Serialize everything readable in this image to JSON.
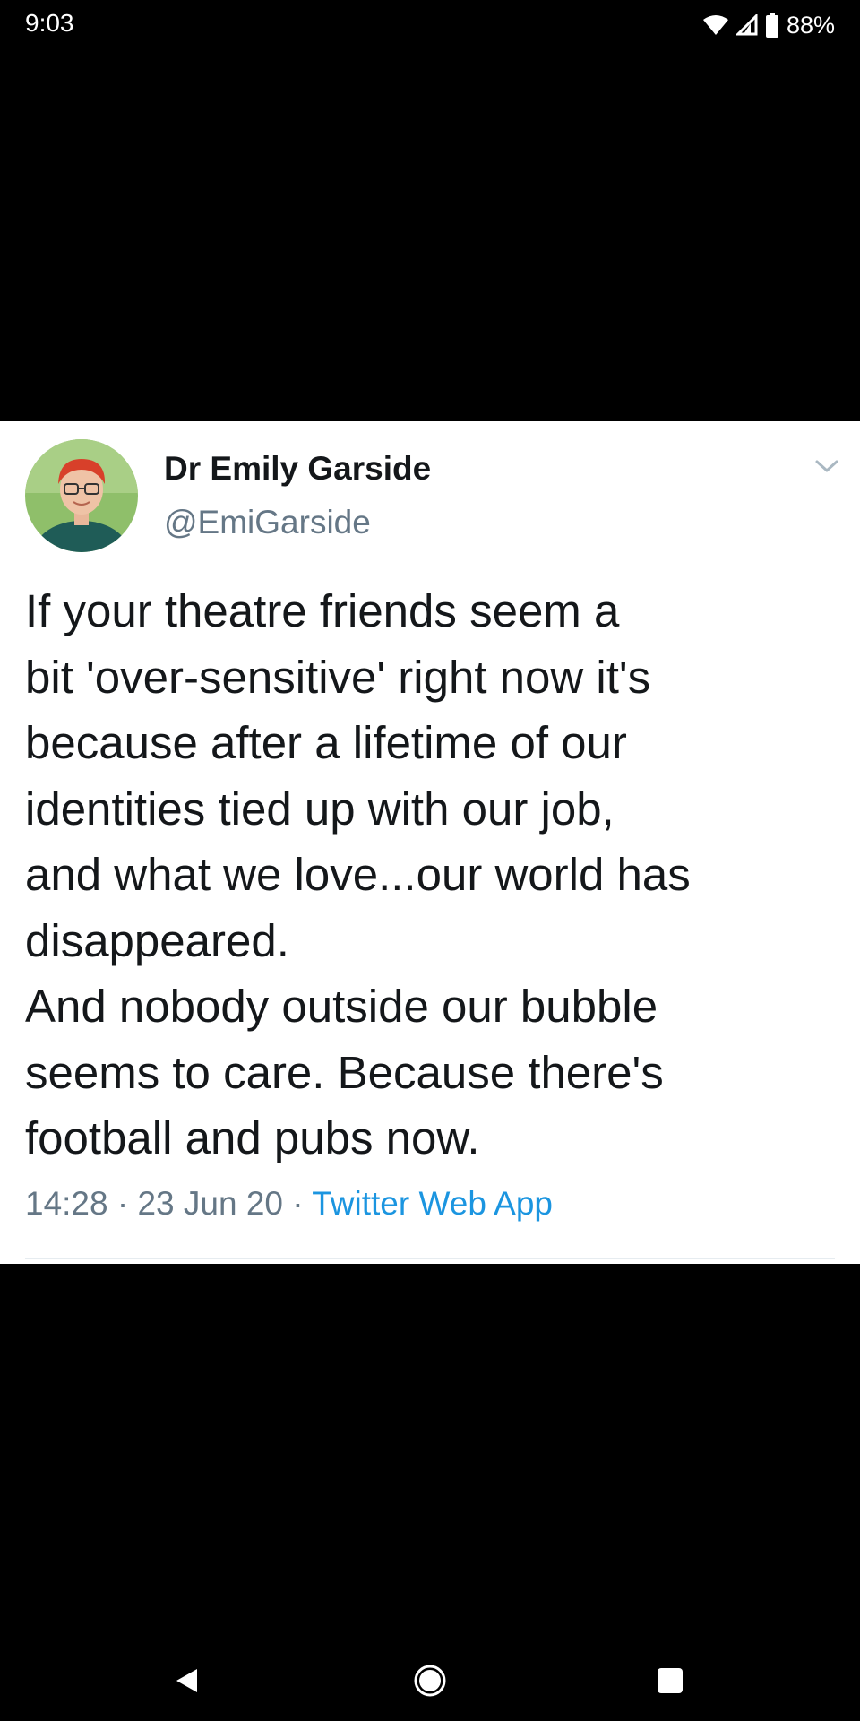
{
  "status_bar": {
    "time": "9:03",
    "battery": "88%",
    "icons": [
      "wifi-icon",
      "cellular-signal-icon",
      "battery-icon"
    ]
  },
  "tweet": {
    "display_name": "Dr Emily Garside",
    "handle": "@EmiGarside",
    "text_lines": [
      "If your theatre friends seem a",
      "bit 'over-sensitive' right now it's",
      "because after a lifetime of our",
      "identities tied up with our job,",
      "and what we love...our world has",
      "disappeared.",
      "And nobody outside our bubble",
      "seems to care. Because there's",
      "football and pubs now."
    ],
    "time": "14:28",
    "separator": "·",
    "date": "23 Jun 20",
    "source": "Twitter Web App"
  },
  "nav_bar": {
    "icons": [
      "back-icon",
      "home-icon",
      "recent-apps-icon"
    ]
  },
  "colors": {
    "background": "#000000",
    "card": "#ffffff",
    "text_primary": "#14171a",
    "text_secondary": "#657786",
    "link": "#1b95e0"
  }
}
